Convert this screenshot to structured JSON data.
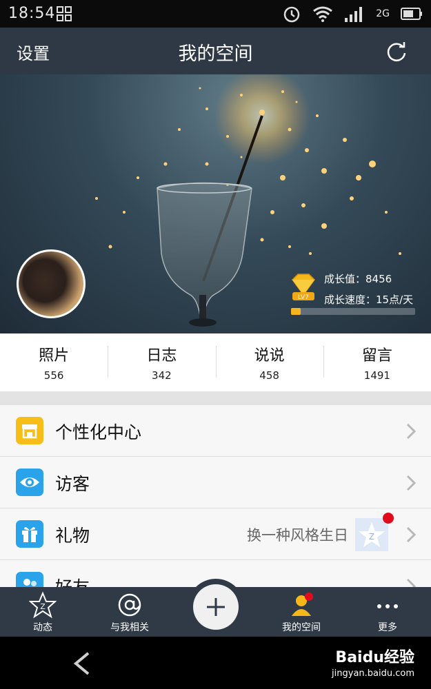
{
  "status_bar": {
    "time": "18:54",
    "network": "2G"
  },
  "header": {
    "left_label": "设置",
    "title": "我的空间"
  },
  "profile": {
    "growth_value": "成长值：8456",
    "growth_speed": "成长速度：15点/天",
    "level_badge": "LV7",
    "progress_fraction": 0.08
  },
  "stats": [
    {
      "label": "照片",
      "count": "556"
    },
    {
      "label": "日志",
      "count": "342"
    },
    {
      "label": "说说",
      "count": "458"
    },
    {
      "label": "留言",
      "count": "1491"
    }
  ],
  "menu": [
    {
      "label": "个性化中心",
      "icon": "shop-icon",
      "color": "#f7bd18"
    },
    {
      "label": "访客",
      "icon": "eye-icon",
      "color": "#2aa3ea"
    },
    {
      "label": "礼物",
      "icon": "gift-icon",
      "color": "#2aa3ea",
      "sub": "换一种风格生日"
    },
    {
      "label": "好友",
      "icon": "friends-icon",
      "color": "#2aa3ea"
    }
  ],
  "tabbar": {
    "items": [
      {
        "label": "动态",
        "icon": "star-z-icon"
      },
      {
        "label": "与我相关",
        "icon": "at-icon"
      },
      {
        "label": "我的空间",
        "icon": "user-icon"
      },
      {
        "label": "更多",
        "icon": "more-dots-icon"
      }
    ]
  },
  "watermark": {
    "brand": "Baidu经验",
    "url": "jingyan.baidu.com"
  }
}
